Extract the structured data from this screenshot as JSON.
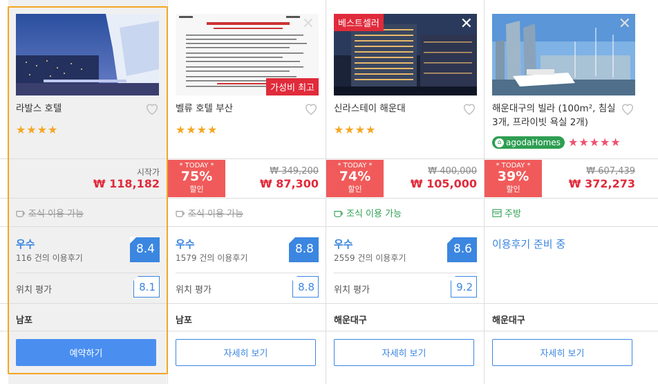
{
  "colors": {
    "accent": "#3b86e0",
    "sale": "#e02b3b",
    "select_border": "#f5a623",
    "green": "#2e9e52"
  },
  "labels": {
    "starting_at": "시작가",
    "today": "* TODAY *",
    "discount_word": "할인",
    "location_rating": "위치 평가"
  },
  "hotels": [
    {
      "name": "라발스 호텔",
      "stars": "★★★★",
      "price_prefix": "시작가",
      "price": "₩ 118,182",
      "amenity": "조식 이용 가능",
      "amenity_icon": "cup-icon",
      "grade": "우수",
      "reviews": "116 건의 이용후기",
      "score": "8.4",
      "location_label": "위치 평가",
      "location_score": "8.1",
      "area": "남포",
      "button": "예약하기"
    },
    {
      "name": "벨류 호텔 부산",
      "stars": "★★★★",
      "badge_bottom": "가성비 최고",
      "today": "* TODAY *",
      "discount": "75%",
      "discount_word": "할인",
      "price_old": "₩ 349,200",
      "price": "₩ 87,300",
      "amenity": "조식 이용 가능",
      "amenity_icon": "cup-icon",
      "grade": "우수",
      "reviews": "1579 건의 이용후기",
      "score": "8.8",
      "location_label": "위치 평가",
      "location_score": "8.8",
      "area": "남포",
      "button": "자세히 보기"
    },
    {
      "name": "신라스테이 해운대",
      "stars": "★★★★",
      "badge_top": "베스트셀러",
      "today": "* TODAY *",
      "discount": "74%",
      "discount_word": "할인",
      "price_old": "₩ 400,000",
      "price": "₩ 105,000",
      "amenity": "조식 이용 가능",
      "amenity_icon": "cup-icon",
      "grade": "우수",
      "reviews": "2559 건의 이용후기",
      "score": "8.6",
      "location_label": "위치 평가",
      "location_score": "9.2",
      "area": "해운대구",
      "button": "자세히 보기"
    },
    {
      "name": "해운대구의 빌라 (100m², 침실 3개, 프라이빗 욕실 2개)",
      "agoda_badge": "agodaHomes",
      "pink_stars": "★★★★★",
      "today": "* TODAY *",
      "discount": "39%",
      "discount_word": "할인",
      "price_old": "₩ 607,439",
      "price": "₩ 372,273",
      "amenity": "주방",
      "amenity_icon": "kitchen-icon",
      "pending": "이용후기 준비 중",
      "area": "해운대구",
      "button": "자세히 보기"
    }
  ]
}
